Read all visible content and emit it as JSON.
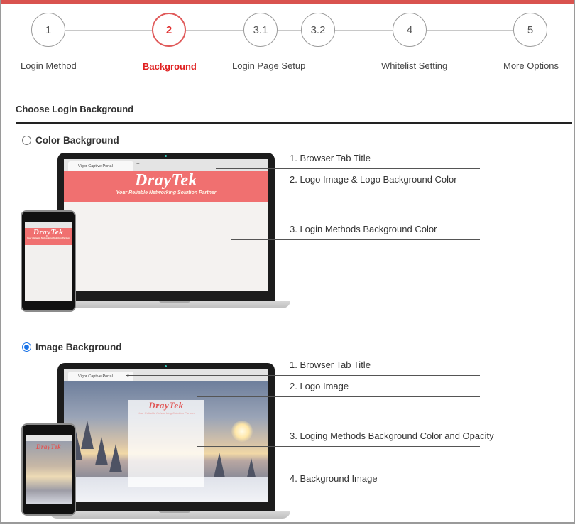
{
  "steps": [
    {
      "number": "1",
      "label": "Login Method",
      "active": false
    },
    {
      "number": "2",
      "label": "Background",
      "active": true
    },
    {
      "number": "3.1",
      "label": "Login Page Setup",
      "active": false
    },
    {
      "number": "3.2",
      "label": "",
      "active": false
    },
    {
      "number": "4",
      "label": "Whitelist Setting",
      "active": false
    },
    {
      "number": "5",
      "label": "More Options",
      "active": false
    }
  ],
  "section_title": "Choose Login Background",
  "options": {
    "color": {
      "label": "Color Background",
      "selected": false,
      "annotations": [
        "1. Browser Tab Title",
        "2. Logo Image & Logo Background Color",
        "3. Login Methods Background Color"
      ]
    },
    "image": {
      "label": "Image Background",
      "selected": true,
      "annotations": [
        "1. Browser Tab Title",
        "2. Logo Image",
        "3. Loging Methods Background Color and Opacity",
        "4. Background Image"
      ]
    }
  },
  "preview": {
    "tab_title": "Vigor Captive Portal",
    "logo_text": "DrayTek",
    "tagline": "Your Reliable Networking Solution Partner",
    "banner_color": "#f07070",
    "accent_color": "#e03030"
  }
}
